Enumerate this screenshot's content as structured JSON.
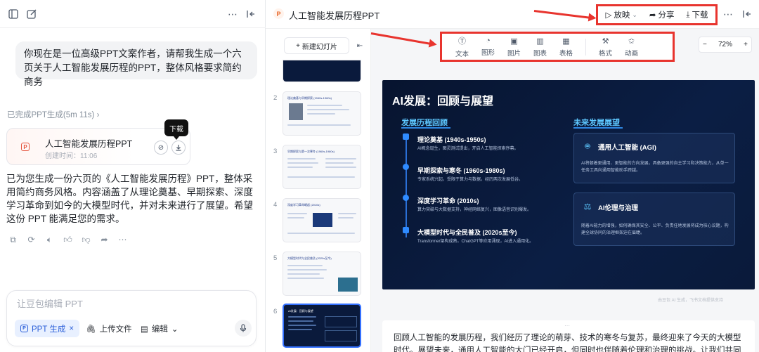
{
  "chat": {
    "user_message": "你现在是一位高级PPT文案作者，请帮我生成一个六页关于人工智能发展历程的PPT，整体风格要求简约商务",
    "status": "已完成PPT生成(5m 11s)",
    "file_card": {
      "badge": "P",
      "name": "人工智能发展历程PPT",
      "time": "创建时间：11:06"
    },
    "tooltip": "下载",
    "assistant_message": "已为您生成一份六页的《人工智能发展历程》PPT，整体采用简约商务风格。内容涵盖了从理论奠基、早期探索、深度学习革命到如今的大模型时代，并对未来进行了展望。希望这份 PPT 能满足您的需求。",
    "composer": {
      "placeholder": "让豆包编辑 PPT",
      "chip_ppt": "PPT 生成",
      "chip_close": "×",
      "upload": "上传文件",
      "edit": "编辑"
    }
  },
  "editor": {
    "doc_badge": "P",
    "title": "人工智能发展历程PPT",
    "actions": {
      "play": "放映",
      "share": "分享",
      "download": "下载"
    },
    "new_slide": "新建幻灯片",
    "tools": [
      "文本",
      "图形",
      "图片",
      "图表",
      "表格",
      "格式",
      "动画"
    ],
    "zoom": "72%",
    "thumbnails": [
      {
        "num": "2",
        "title": "理论奠基与早期探索 (1940s-1960s)"
      },
      {
        "num": "3",
        "title": "早期探索与第一次寒冬 (1960s-1980s)"
      },
      {
        "num": "4",
        "title": "深度学习革命崛起 (2010s)"
      },
      {
        "num": "5",
        "title": "大模型时代与全民普及 (2020s至今)"
      },
      {
        "num": "6",
        "title": "AI发展：回顾与展望"
      }
    ],
    "slide": {
      "title": "AI发展：回顾与展望",
      "left_heading": "发展历程回顾",
      "right_heading": "未来发展展望",
      "events": [
        {
          "title": "理论奠基 (1940s-1950s)",
          "desc": "AI概念诞生，图灵测试提出，开启人工智能探索序幕。"
        },
        {
          "title": "早期探索与寒冬 (1960s-1980s)",
          "desc": "专家系统兴起，受限于算力与数据，经历两次发展低谷。"
        },
        {
          "title": "深度学习革命 (2010s)",
          "desc": "算力突破与大数据支持，神经网络复兴，图像语音识别爆发。"
        },
        {
          "title": "大模型时代与全民普及 (2020s至今)",
          "desc": "Transformer架构成熟，ChatGPT等应用涌现，AI进入通用化。"
        }
      ],
      "cards": [
        {
          "icon": "robot-icon",
          "title": "通用人工智能 (AGI)",
          "desc": "AI将朝着更通用、更智能的方向发展，具备更强的自主学习和决策能力，从单一任务工具向通用智能助手跨越。"
        },
        {
          "icon": "scale-icon",
          "title": "AI伦理与治理",
          "desc": "随着AI能力的增强，如何确保其安全、公平、负责任地发展将成为核心议题，构建全球协同的治理框架迫在眉睫。"
        }
      ]
    },
    "watermark": "由豆包 AI 生成，飞书文档提供支持",
    "notes": "回顾人工智能的发展历程，我们经历了理论的萌芽、技术的寒冬与复苏，最终迎来了今天的大模型时代。展望未来，通用人工智能的大门已经开启，但同时也伴随着伦理和治理的挑战。让我们共同期待一"
  },
  "colors": {
    "annotation_red": "#e8342e",
    "accent_blue": "#3370ff",
    "slide_bg": "#07142f"
  }
}
